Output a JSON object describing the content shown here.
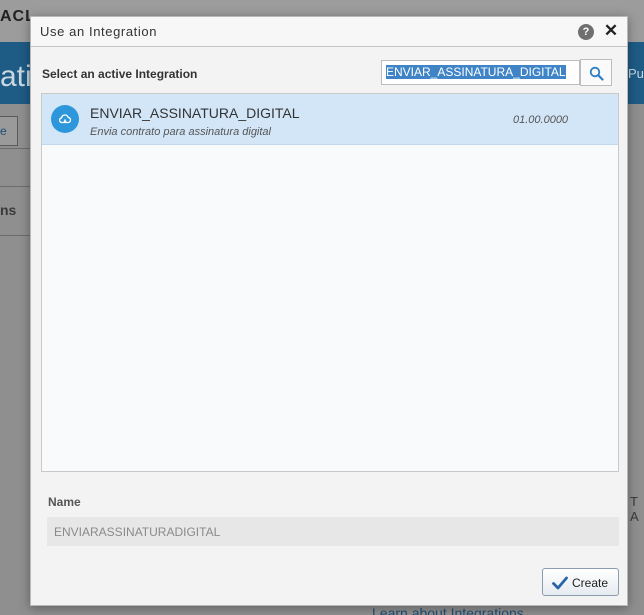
{
  "background": {
    "logo_text": "ACL",
    "band_title": "atic",
    "band_right": "Pu",
    "tab_label": "e",
    "section_label": "ns",
    "right_label": "T A",
    "link_text": "Learn about Integrations"
  },
  "dialog": {
    "title": "Use an Integration",
    "help_label": "?",
    "close_label": "✕",
    "section_label": "Select an active Integration",
    "search": {
      "value": "ENVIAR_ASSINATURA_DIGITAL"
    },
    "integrations": [
      {
        "name": "ENVIAR_ASSINATURA_DIGITAL",
        "description": "Envia contrato para assinatura digital",
        "version": "01.00.0000",
        "icon": "cloud-icon"
      }
    ],
    "name_label": "Name",
    "name_value": "ENVIARASSINATURADIGITAL",
    "create_label": "Create"
  },
  "colors": {
    "accent": "#2e97dc",
    "selected_row": "#d3e6f8",
    "band": "#1e5b85"
  }
}
